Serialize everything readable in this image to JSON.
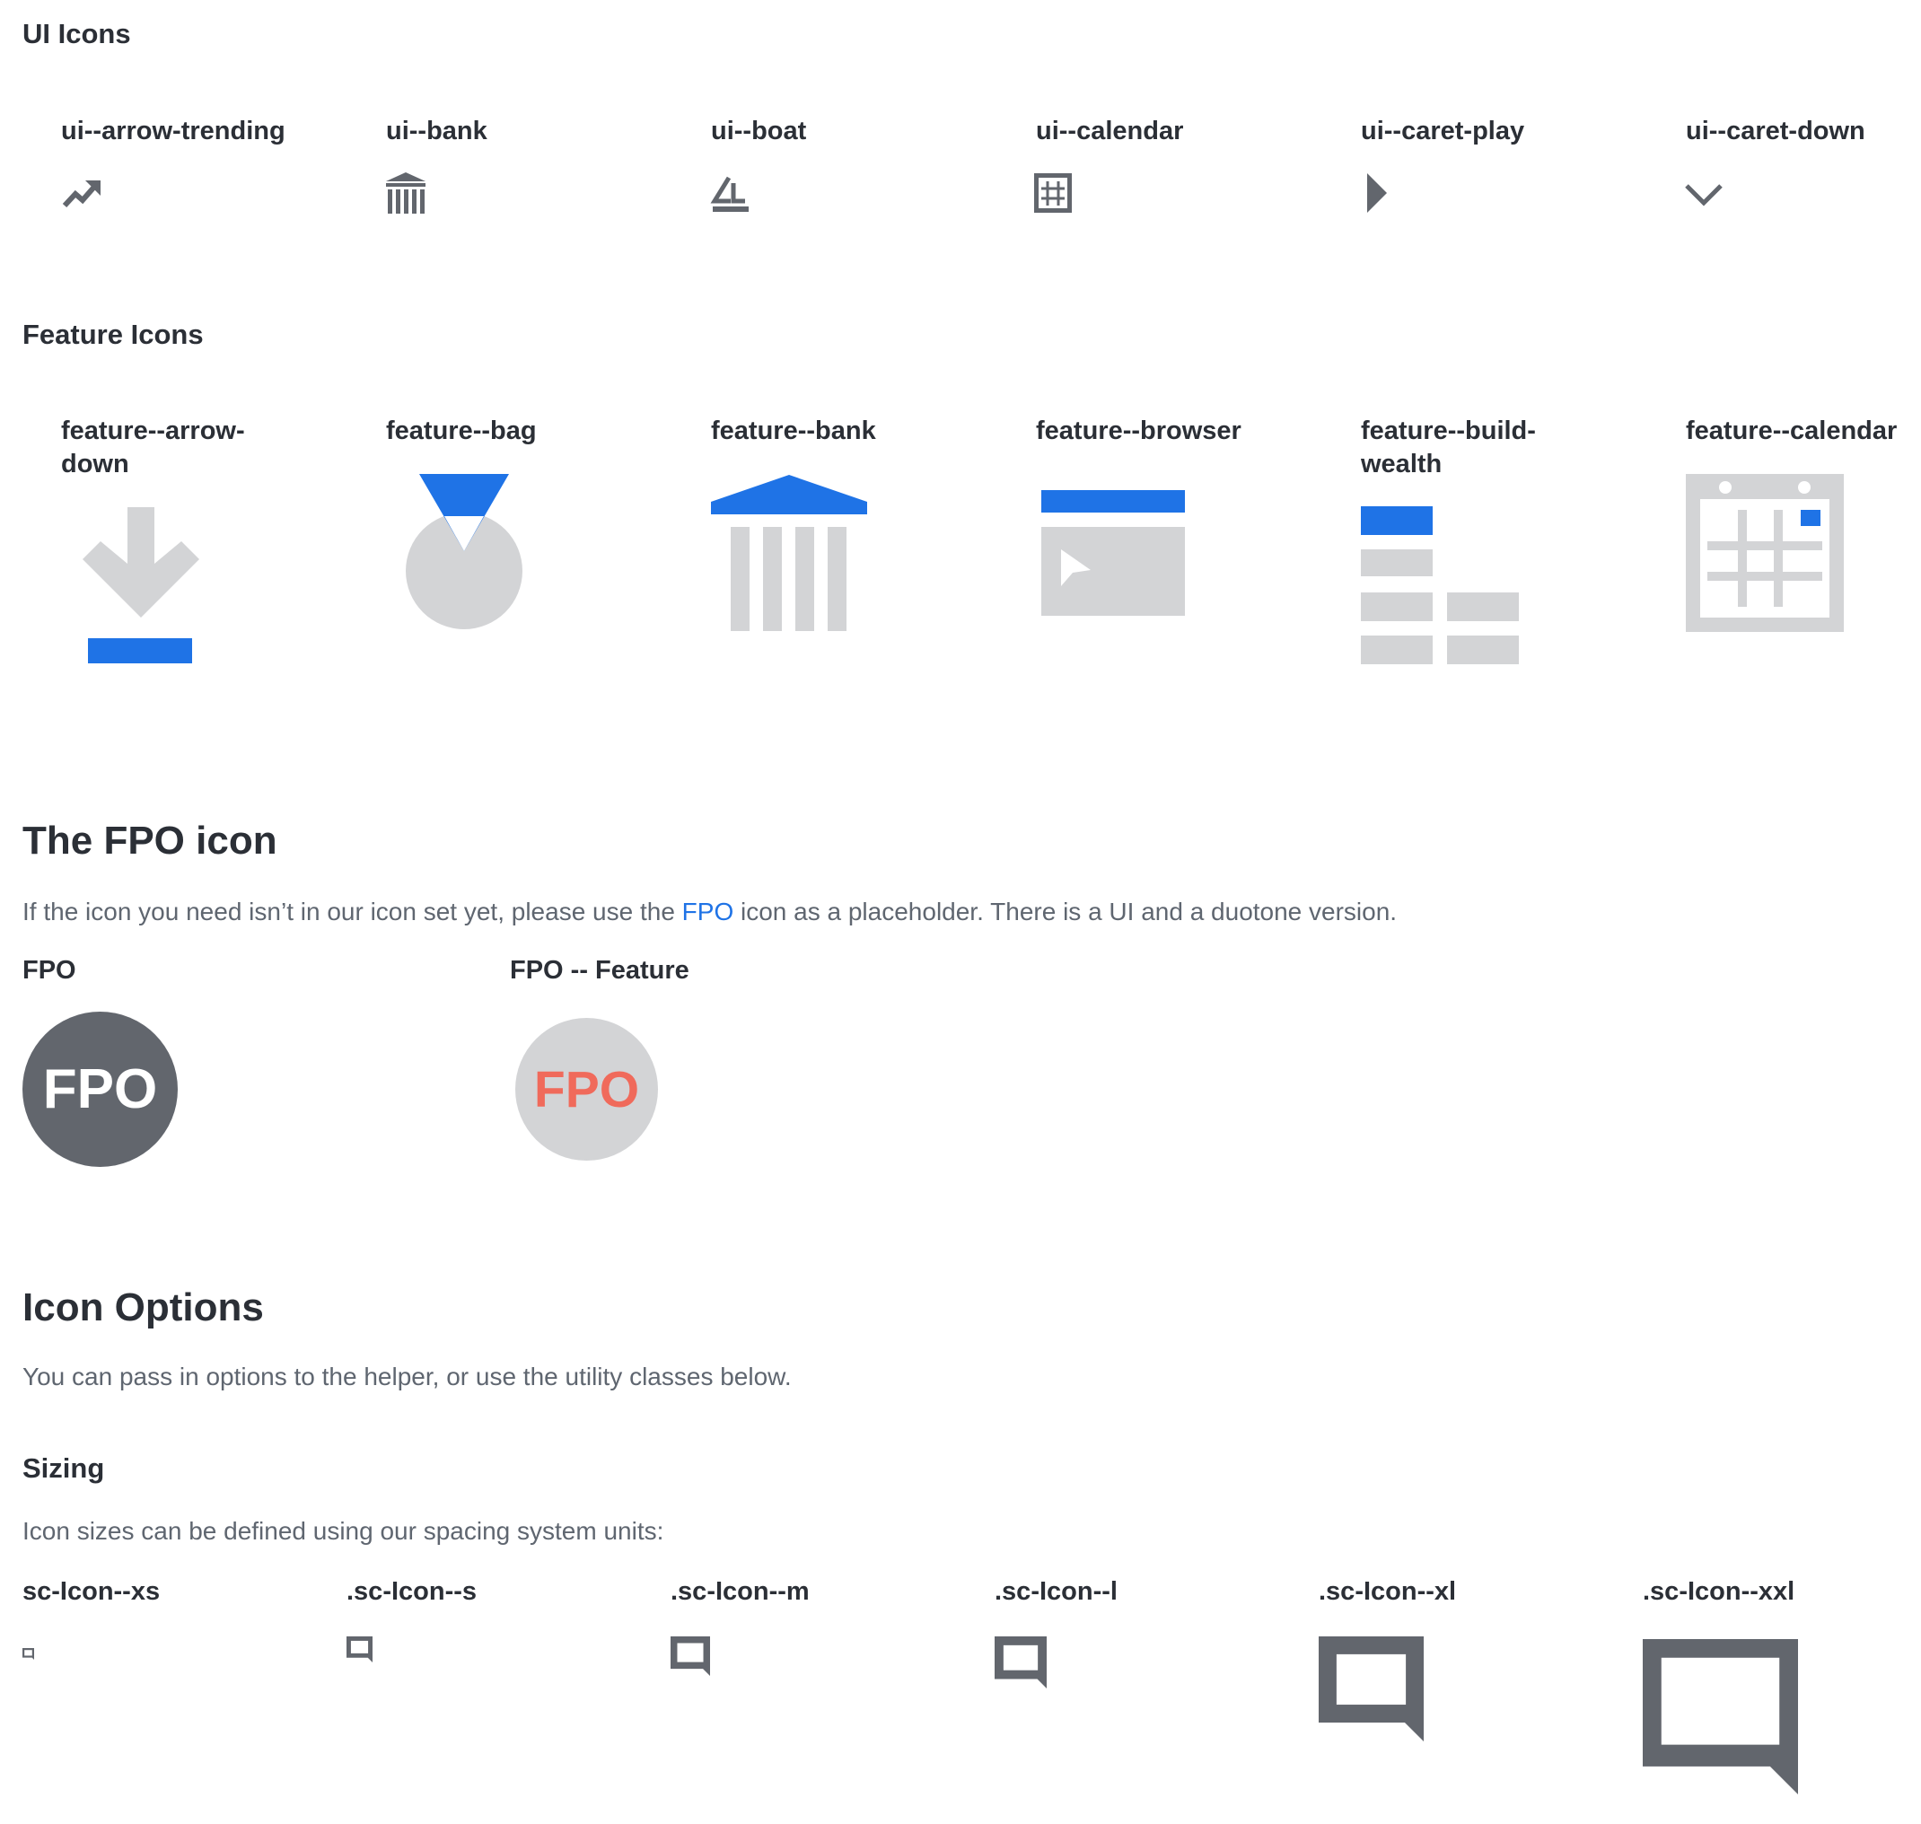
{
  "ui_icons": {
    "heading": "UI Icons",
    "items": [
      {
        "label": "ui--arrow-trending",
        "icon": "arrow-trending-icon"
      },
      {
        "label": "ui--bank",
        "icon": "bank-icon"
      },
      {
        "label": "ui--boat",
        "icon": "boat-icon"
      },
      {
        "label": "ui--calendar",
        "icon": "calendar-icon"
      },
      {
        "label": "ui--caret-play",
        "icon": "caret-play-icon"
      },
      {
        "label": "ui--caret-down",
        "icon": "caret-down-icon"
      }
    ]
  },
  "feature_icons": {
    "heading": "Feature Icons",
    "items": [
      {
        "label_line1": "feature--arrow-",
        "label_line2": "down",
        "icon": "arrow-down-icon"
      },
      {
        "label_line1": "feature--bag",
        "label_line2": "",
        "icon": "bag-icon"
      },
      {
        "label_line1": "feature--bank",
        "label_line2": "",
        "icon": "bank-icon"
      },
      {
        "label_line1": "feature--browser",
        "label_line2": "",
        "icon": "browser-icon"
      },
      {
        "label_line1": "feature--build-",
        "label_line2": "wealth",
        "icon": "build-wealth-icon"
      },
      {
        "label_line1": "feature--calendar",
        "label_line2": "",
        "icon": "calendar-icon"
      }
    ]
  },
  "fpo": {
    "heading": "The FPO icon",
    "description_before": "If the icon you need isn’t in our icon set yet, please use the ",
    "description_link": "FPO",
    "description_after": " icon as a placeholder. There is a UI and a duotone version.",
    "ui_label": "FPO",
    "ui_icon_text": "FPO",
    "feature_label": "FPO -- Feature",
    "feature_icon_text": "FPO"
  },
  "options": {
    "heading": "Icon Options",
    "description": "You can pass in options to the helper, or use the utility classes below."
  },
  "sizing": {
    "heading": "Sizing",
    "description": "Icon sizes can be defined using our spacing system units:",
    "items": [
      {
        "label": "sc-Icon--xs",
        "icon": "speech-bubble-icon"
      },
      {
        "label": ".sc-Icon--s",
        "icon": "speech-bubble-icon"
      },
      {
        "label": ".sc-Icon--m",
        "icon": "speech-bubble-icon"
      },
      {
        "label": ".sc-Icon--l",
        "icon": "speech-bubble-icon"
      },
      {
        "label": ".sc-Icon--xl",
        "icon": "speech-bubble-icon"
      },
      {
        "label": ".sc-Icon--xxl",
        "icon": "speech-bubble-icon"
      }
    ]
  },
  "colors": {
    "ui_gray": "#62666d",
    "feature_gray": "#d3d4d6",
    "feature_blue": "#1f73e6",
    "fpo_red": "#f06a5b",
    "link_blue": "#1f73e6"
  }
}
